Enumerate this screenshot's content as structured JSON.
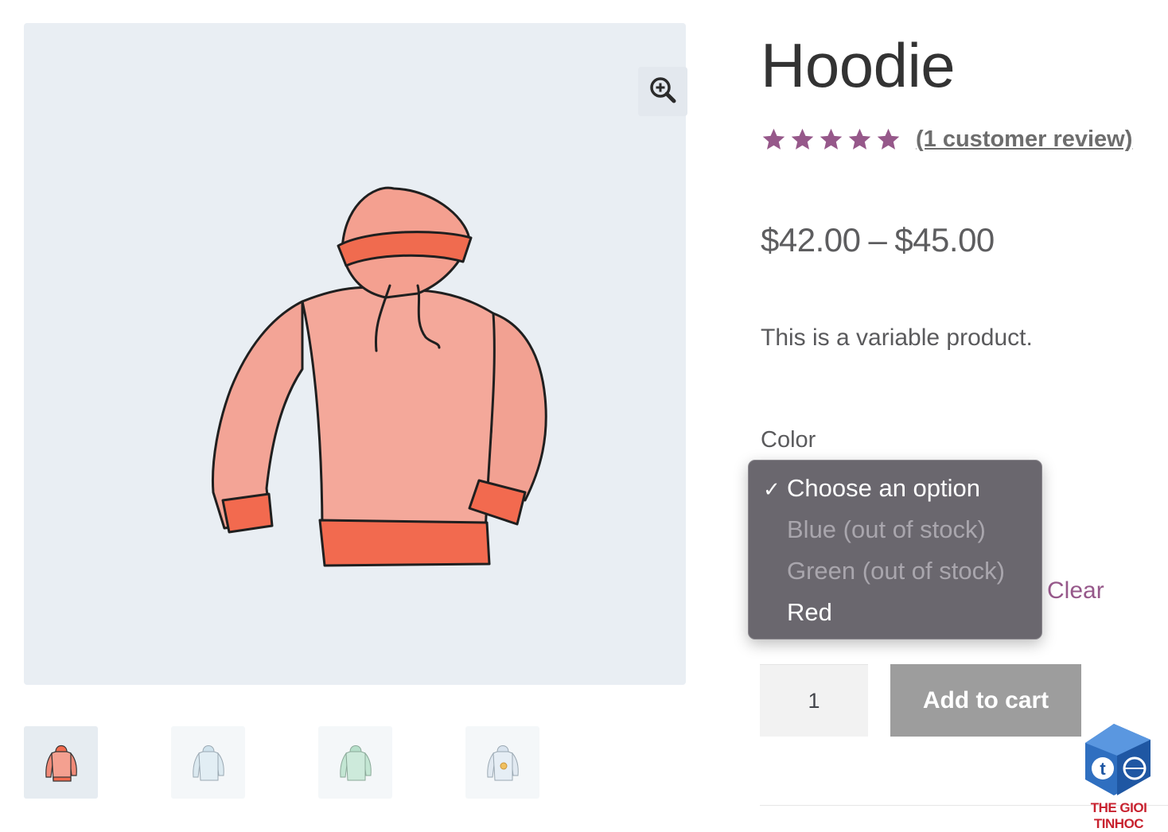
{
  "product": {
    "title": "Hoodie",
    "rating": {
      "value": 5,
      "max": 5,
      "review_text": "(1 customer review)"
    },
    "price_min": "$42.00",
    "price_dash": "–",
    "price_max": "$45.00",
    "description": "This is a variable product."
  },
  "variation": {
    "label": "Color",
    "options": [
      {
        "label": "Choose an option",
        "selected": true,
        "disabled": false
      },
      {
        "label": "Blue (out of stock)",
        "selected": false,
        "disabled": true
      },
      {
        "label": "Green (out of stock)",
        "selected": false,
        "disabled": true
      },
      {
        "label": "Red",
        "selected": false,
        "disabled": false
      }
    ],
    "clear_label": "Clear"
  },
  "cart": {
    "quantity": "1",
    "add_label": "Add to cart"
  },
  "gallery": {
    "thumbnails": [
      {
        "name": "thumbnail-red-hoodie",
        "color": "#f08a78"
      },
      {
        "name": "thumbnail-blue-hoodie",
        "color": "#d6e6ee"
      },
      {
        "name": "thumbnail-green-hoodie",
        "color": "#bfe3d0"
      },
      {
        "name": "thumbnail-logo-hoodie",
        "color": "#dde7f0"
      }
    ]
  },
  "colors": {
    "star": "#96588a",
    "link": "#96588a",
    "button": "#9d9d9d",
    "image_bg": "#e9eef3"
  },
  "watermark": {
    "text": "THE GIOI TINHOC"
  }
}
